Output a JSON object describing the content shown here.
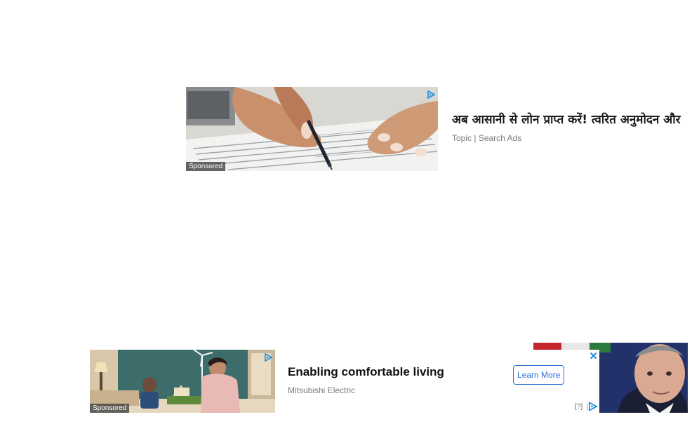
{
  "ad_top": {
    "title": "अब आसानी से लोन प्राप्त करें! त्वरित अनुमोदन और",
    "topic": "Topic",
    "separator": "|",
    "source": "Search Ads",
    "sponsored": "Sponsored",
    "image_icon": "hand-signing-form-image"
  },
  "ad_bottom": {
    "title": "Enabling comfortable living",
    "advertiser": "Mitsubishi Electric",
    "cta": "Learn More",
    "sponsored": "Sponsored",
    "help": "[?]",
    "close": "✕",
    "image_icon": "family-house-model-image"
  },
  "side_photo": {
    "image_icon": "politician-portrait-image"
  },
  "colors": {
    "link_blue": "#2e6fd0",
    "adchoices_blue": "#1a8fd8",
    "meta_gray": "#7a7a7a"
  }
}
